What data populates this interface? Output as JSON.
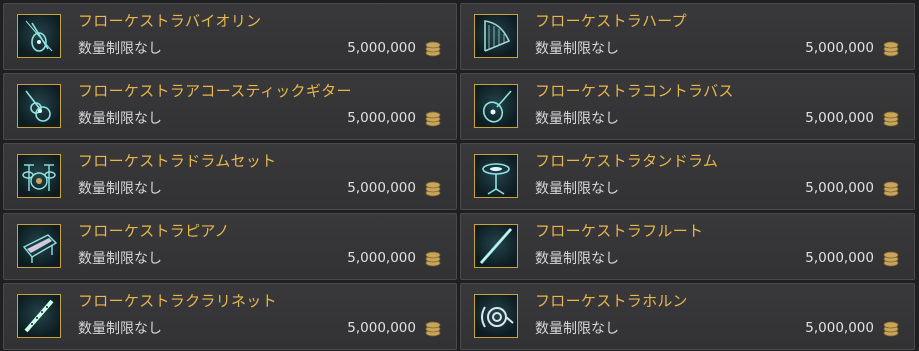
{
  "items": [
    {
      "name": "フローケストラバイオリン",
      "quantity": "数量制限なし",
      "price": "5,000,000",
      "icon": "violin-icon"
    },
    {
      "name": "フローケストラハープ",
      "quantity": "数量制限なし",
      "price": "5,000,000",
      "icon": "harp-icon"
    },
    {
      "name": "フローケストラアコースティックギター",
      "quantity": "数量制限なし",
      "price": "5,000,000",
      "icon": "acoustic-guitar-icon"
    },
    {
      "name": "フローケストラコントラバス",
      "quantity": "数量制限なし",
      "price": "5,000,000",
      "icon": "contrabass-icon"
    },
    {
      "name": "フローケストラドラムセット",
      "quantity": "数量制限なし",
      "price": "5,000,000",
      "icon": "drum-set-icon"
    },
    {
      "name": "フローケストラタンドラム",
      "quantity": "数量制限なし",
      "price": "5,000,000",
      "icon": "tam-drum-icon"
    },
    {
      "name": "フローケストラピアノ",
      "quantity": "数量制限なし",
      "price": "5,000,000",
      "icon": "piano-icon"
    },
    {
      "name": "フローケストラフルート",
      "quantity": "数量制限なし",
      "price": "5,000,000",
      "icon": "flute-icon"
    },
    {
      "name": "フローケストラクラリネット",
      "quantity": "数量制限なし",
      "price": "5,000,000",
      "icon": "clarinet-icon"
    },
    {
      "name": "フローケストラホルン",
      "quantity": "数量制限なし",
      "price": "5,000,000",
      "icon": "horn-icon"
    }
  ],
  "currency_icon": "gil-coin-icon",
  "colors": {
    "name": "#e8b64a",
    "frame": "#caa23a",
    "glow": "#8fe3e3"
  }
}
